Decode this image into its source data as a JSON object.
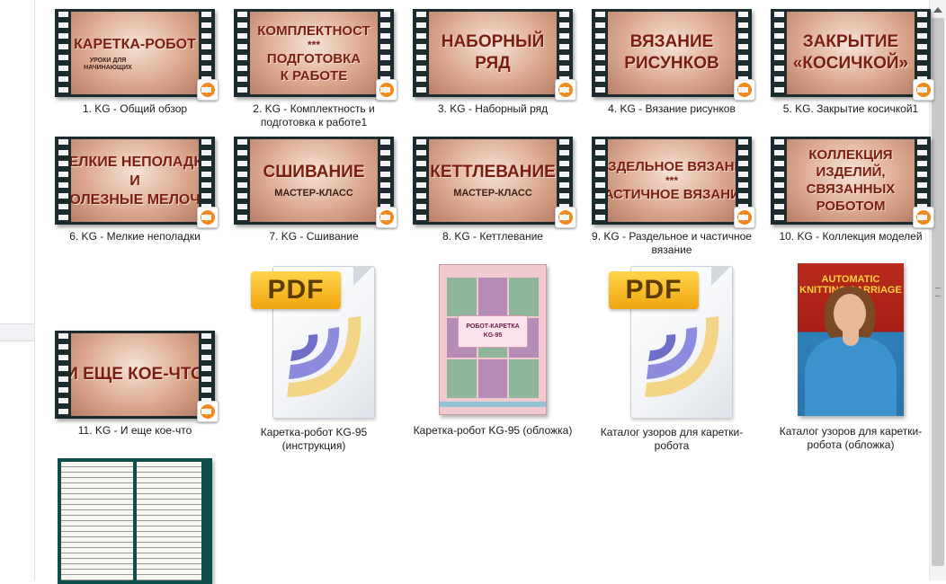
{
  "items": [
    {
      "caption": "1. KG - Общий обзор",
      "lines": [
        "КАРЕТКА-РОБОТ"
      ],
      "sub": "УРОКИ ДЛЯ НАЧИНАЮЩИХ"
    },
    {
      "caption": "2. KG - Комплектность и подготовка к работе1",
      "lines": [
        "КОМПЛЕКТНОСТ",
        "***",
        "ПОДГОТОВКА",
        "К РАБОТЕ"
      ]
    },
    {
      "caption": "3. KG - Наборный ряд",
      "lines": [
        "НАБОРНЫЙ",
        "РЯД"
      ]
    },
    {
      "caption": "4. KG - Вязание рисунков",
      "lines": [
        "ВЯЗАНИЕ",
        "РИСУНКОВ"
      ]
    },
    {
      "caption": "5. KG. Закрытие косичкой1",
      "lines": [
        "ЗАКРЫТИЕ",
        "«КОСИЧКОЙ»"
      ]
    },
    {
      "caption": "6. KG - Мелкие неполадки",
      "lines": [
        "МЕЛКИЕ НЕПОЛАДКИ",
        "И",
        "ПОЛЕЗНЫЕ МЕЛОЧИ"
      ]
    },
    {
      "caption": "7. KG - Сшивание",
      "lines": [
        "СШИВАНИЕ"
      ],
      "sub": "МАСТЕР-КЛАСС"
    },
    {
      "caption": "8. KG - Кеттлевание",
      "lines": [
        "КЕТТЛЕВАНИЕ"
      ],
      "sub": "МАСТЕР-КЛАСС"
    },
    {
      "caption": "9. KG - Раздельное и частичное вязание",
      "lines": [
        "РАЗДЕЛЬНОЕ ВЯЗАНИЕ",
        "***",
        "ЧАСТИЧНОЕ ВЯЗАНИЕ"
      ]
    },
    {
      "caption": "10. KG - Коллекция моделей",
      "lines": [
        "КОЛЛЕКЦИЯ",
        "ИЗДЕЛИЙ,",
        "СВЯЗАННЫХ",
        "РОБОТОМ"
      ]
    },
    {
      "caption": "11. KG - И еще кое-что",
      "lines": [
        "И ЕЩЕ КОЕ-ЧТО"
      ]
    },
    {
      "caption": "Каретка-робот KG-95 (инструкция)",
      "pdf_label": "PDF"
    },
    {
      "caption": "Каретка-робот KG-95 (обложка)",
      "cover_text": [
        "РОБОТ-КАРЕТКА",
        "KG-95"
      ]
    },
    {
      "caption": "Каталог узоров  для каретки-робота",
      "pdf_label": "PDF"
    },
    {
      "caption": "Каталог узоров для каретки-робота (обложка)",
      "cover_title": [
        "AUTOMATIC",
        "KNITTING CARRIAGE"
      ]
    },
    {
      "caption": ""
    }
  ]
}
